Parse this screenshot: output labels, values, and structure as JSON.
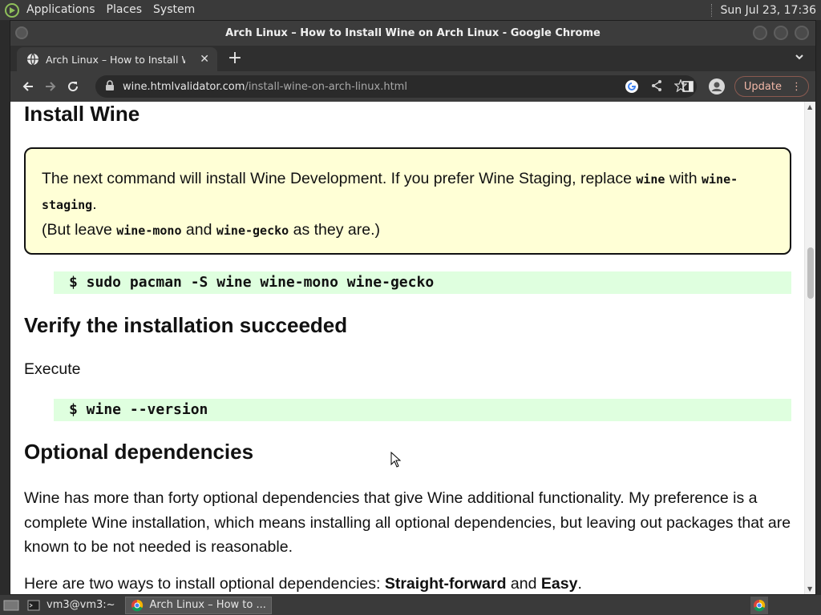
{
  "top_panel": {
    "menus": [
      "Applications",
      "Places",
      "System"
    ],
    "clock": "Sun Jul 23, 17:36"
  },
  "window": {
    "title": "Arch Linux – How to Install Wine on Arch Linux - Google Chrome"
  },
  "tab": {
    "title": "Arch Linux – How to Install Wine on Arch Linux",
    "close": "✕",
    "new_tab": "+"
  },
  "toolbar": {
    "url_domain": "wine.htmlvalidator.com",
    "url_path": "/install-wine-on-arch-linux.html",
    "update_label": "Update"
  },
  "page": {
    "h_install": "Install Wine",
    "note_line1_pre": "The next command will install Wine Development. If you prefer Wine Staging, replace ",
    "note_code_wine": "wine",
    "note_line1_mid": " with ",
    "note_code_wine_staging": "wine-staging",
    "note_line1_end": ".",
    "note_line2_pre": "(But leave ",
    "note_code_mono": "wine-mono",
    "note_line2_and": " and ",
    "note_code_gecko": "wine-gecko",
    "note_line2_end": " as they are.)",
    "cmd_install": "$ sudo pacman -S wine wine-mono wine-gecko",
    "h_verify": "Verify the installation succeeded",
    "p_execute": "Execute",
    "cmd_version": "$ wine --version",
    "h_optional": "Optional dependencies",
    "p_wine": "Wine has more than forty optional dependencies that give Wine additional functionality. My preference is a complete Wine installation, which means installing all optional dependencies, but leaving out packages that are known to be not needed is reasonable.",
    "p_two_pre": "Here are two ways to install optional dependencies: ",
    "p_two_b1": "Straight-forward",
    "p_two_and": " and ",
    "p_two_b2": "Easy",
    "p_two_end": "."
  },
  "taskbar": {
    "items": [
      "vm3@vm3:~",
      "Arch Linux – How to ..."
    ]
  }
}
